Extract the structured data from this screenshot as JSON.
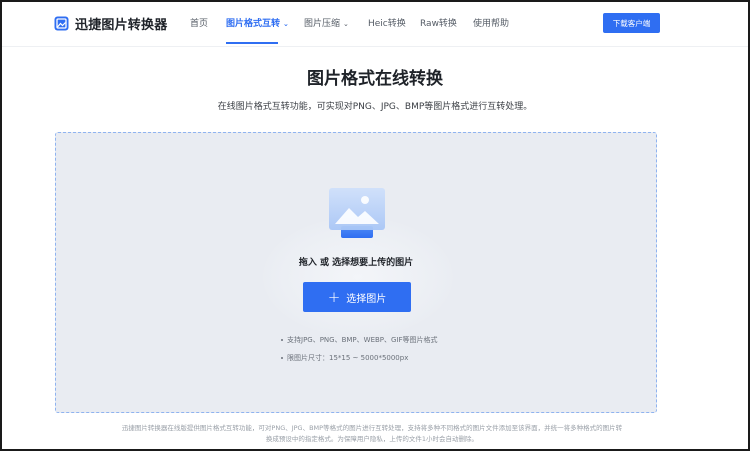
{
  "header": {
    "logo_text": "迅捷图片转换器",
    "nav": [
      {
        "label": "首页",
        "active": false,
        "dropdown": false
      },
      {
        "label": "图片格式互转",
        "active": true,
        "dropdown": true
      },
      {
        "label": "图片压缩",
        "active": false,
        "dropdown": true
      },
      {
        "label": "Heic转换",
        "active": false,
        "dropdown": false
      },
      {
        "label": "Raw转换",
        "active": false,
        "dropdown": false
      },
      {
        "label": "使用帮助",
        "active": false,
        "dropdown": false
      }
    ],
    "download_label": "下载客户端"
  },
  "main": {
    "title": "图片格式在线转换",
    "subtitle": "在线图片格式互转功能，可实现对PNG、JPG、BMP等图片格式进行互转处理。",
    "upload": {
      "drop_text": "拖入 或 选择想要上传的图片",
      "button_label": "选择图片",
      "notes": [
        "支持JPG、PNG、BMP、WEBP、GIF等图片格式",
        "限图片尺寸：15*15 ~ 5000*5000px"
      ]
    },
    "footer_lines": [
      "迅捷图片转换器在线版提供图片格式互转功能，可对PNG、JPG、BMP等格式的图片进行互转处理，支持将多种不同格式的图片文件添加至该界面，并统一将多种格式的图片转",
      "换成预设中的指定格式。为保障用户隐私，上传的文件1小时会自动删除。"
    ]
  },
  "colors": {
    "accent": "#2f6ef2",
    "zone_bg": "#e9ecf2",
    "zone_border": "#8fb3f0"
  }
}
